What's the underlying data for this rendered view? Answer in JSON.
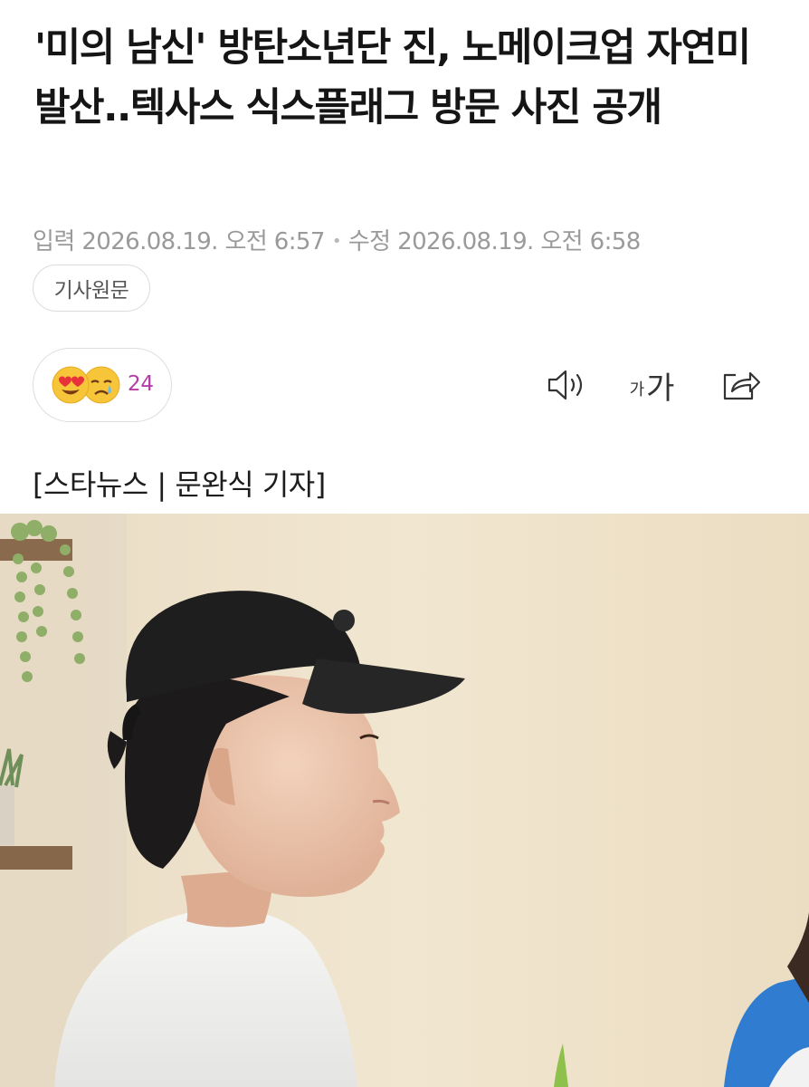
{
  "article": {
    "headline": "'미의 남신' 방탄소년단 진, 노메이크업 자연미 발산..텍사스 식스플래그 방문 사진 공개",
    "input_label": "입력",
    "input_time": "2026.08.19. 오전 6:57",
    "edit_label": "수정",
    "edit_time": "2026.08.19. 오전 6:58",
    "original_button": "기사원문",
    "byline": "[스타뉴스 | 문완식 기자]"
  },
  "reactions": {
    "icons": [
      "heart-eyes-emoji",
      "crying-face-emoji"
    ],
    "count": "24",
    "count_color": "#b43ca8"
  },
  "toolbar": {
    "speaker_icon": "speaker-icon",
    "font_small_glyph": "가",
    "font_big_glyph": "가",
    "share_icon": "share-icon"
  }
}
